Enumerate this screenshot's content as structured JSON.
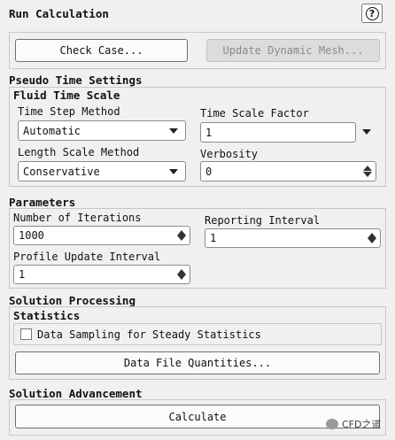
{
  "header": {
    "title": "Run Calculation",
    "help_label": "?"
  },
  "top_buttons": {
    "check_case": "Check Case...",
    "update_dynamic_mesh": "Update Dynamic Mesh..."
  },
  "pseudo_time": {
    "section_title": "Pseudo Time Settings",
    "fluid_time_scale_title": "Fluid Time Scale",
    "time_step_method_label": "Time Step Method",
    "time_step_method_value": "Automatic",
    "time_scale_factor_label": "Time Scale Factor",
    "time_scale_factor_value": "1",
    "length_scale_method_label": "Length Scale Method",
    "length_scale_method_value": "Conservative",
    "verbosity_label": "Verbosity",
    "verbosity_value": "0"
  },
  "parameters": {
    "section_title": "Parameters",
    "num_iterations_label": "Number of Iterations",
    "num_iterations_value": "1000",
    "reporting_interval_label": "Reporting Interval",
    "reporting_interval_value": "1",
    "profile_update_label": "Profile Update Interval",
    "profile_update_value": "1"
  },
  "solution_processing": {
    "section_title": "Solution Processing",
    "statistics_title": "Statistics",
    "data_sampling_label": "Data Sampling for Steady Statistics",
    "data_sampling_checked": false,
    "data_file_quantities": "Data File Quantities..."
  },
  "solution_advancement": {
    "section_title": "Solution Advancement",
    "calculate": "Calculate"
  },
  "watermark": {
    "text": "CFD之道"
  }
}
